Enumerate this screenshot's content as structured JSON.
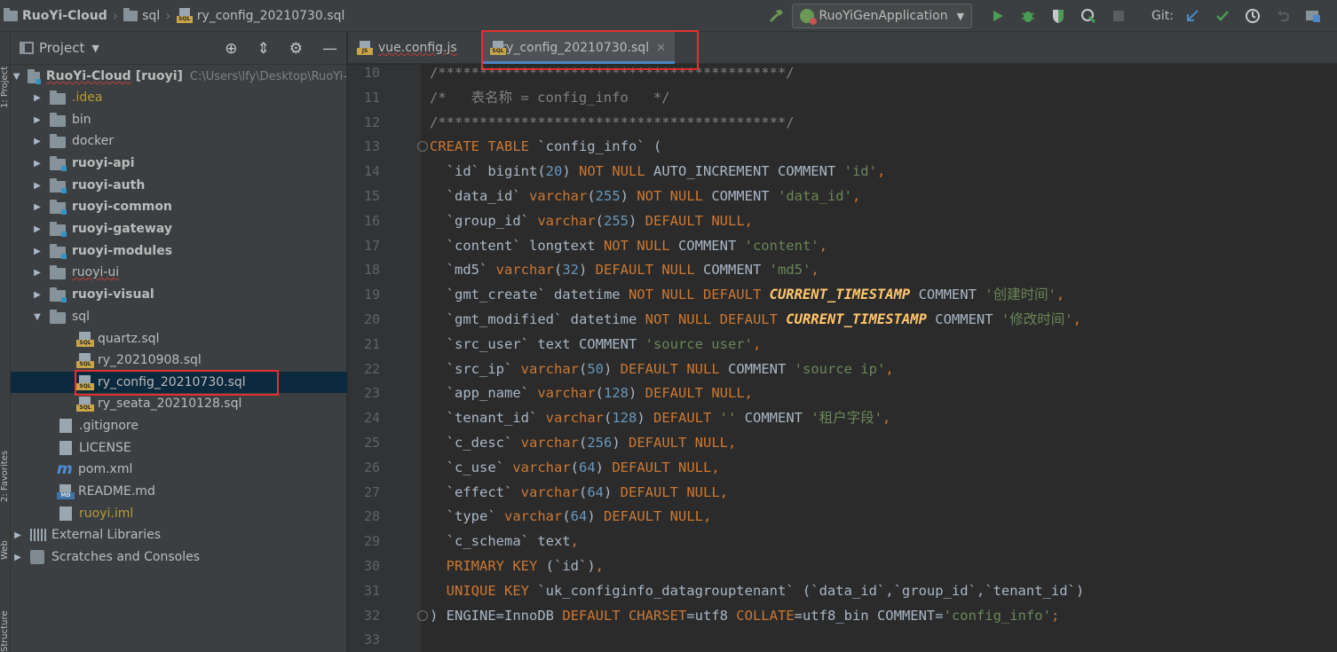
{
  "breadcrumb": {
    "project": "RuoYi-Cloud",
    "folder": "sql",
    "file": "ry_config_20210730.sql"
  },
  "toolbar": {
    "run_config": "RuoYiGenApplication",
    "git_label": "Git:",
    "icons": [
      "hammer-icon",
      "run-icon",
      "debug-icon",
      "coverage-icon",
      "profile-icon",
      "stop-icon",
      "git-update-icon",
      "git-commit-icon",
      "history-icon",
      "rollback-icon",
      "project-structure-icon"
    ],
    "colors": {
      "run": "#499c54",
      "accent": "#4a88c7",
      "selection": "#0d293e"
    }
  },
  "left_strip": {
    "project_label": "1: Project",
    "favorites_label": "2: Favorites",
    "web_label": "Web",
    "structure_label": "Structure"
  },
  "project_panel": {
    "title": "Project",
    "root_name": "RuoYi-Cloud",
    "root_module": "[ruoyi]",
    "root_path": "C:\\Users\\lfy\\Desktop\\RuoYi-",
    "items": [
      {
        "label": ".idea"
      },
      {
        "label": "bin"
      },
      {
        "label": "docker"
      },
      {
        "label": "ruoyi-api"
      },
      {
        "label": "ruoyi-auth"
      },
      {
        "label": "ruoyi-common"
      },
      {
        "label": "ruoyi-gateway"
      },
      {
        "label": "ruoyi-modules"
      },
      {
        "label": "ruoyi-ui"
      },
      {
        "label": "ruoyi-visual"
      },
      {
        "label": "sql"
      },
      {
        "label": "quartz.sql"
      },
      {
        "label": "ry_20210908.sql"
      },
      {
        "label": "ry_config_20210730.sql"
      },
      {
        "label": "ry_seata_20210128.sql"
      },
      {
        "label": ".gitignore"
      },
      {
        "label": "LICENSE"
      },
      {
        "label": "pom.xml"
      },
      {
        "label": "README.md"
      },
      {
        "label": "ruoyi.iml"
      },
      {
        "label": "External Libraries"
      },
      {
        "label": "Scratches and Consoles"
      }
    ]
  },
  "editor": {
    "tabs": [
      {
        "label": "vue.config.js",
        "icon_badge": "JS"
      },
      {
        "label": "ry_config_20210730.sql",
        "icon_badge": "SQL"
      }
    ],
    "line_numbers": [
      "10",
      "11",
      "12",
      "13",
      "14",
      "15",
      "16",
      "17",
      "18",
      "19",
      "20",
      "21",
      "22",
      "23",
      "24",
      "25",
      "26",
      "27",
      "28",
      "29",
      "30",
      "31",
      "32",
      "33"
    ],
    "code": [
      [
        {
          "t": "/******************************************/",
          "c": "comment"
        }
      ],
      [
        {
          "t": "/*   表名称 = config_info   */",
          "c": "comment"
        }
      ],
      [
        {
          "t": "/******************************************/",
          "c": "comment"
        }
      ],
      [
        {
          "t": "CREATE TABLE",
          "c": "kw"
        },
        {
          "t": " `config_info` (",
          "c": "id"
        }
      ],
      [
        {
          "t": "  `id` bigint(",
          "c": "id"
        },
        {
          "t": "20",
          "c": "num"
        },
        {
          "t": ") ",
          "c": "id"
        },
        {
          "t": "NOT NULL",
          "c": "kw"
        },
        {
          "t": " AUTO_INCREMENT COMMENT ",
          "c": "id"
        },
        {
          "t": "'id'",
          "c": "str"
        },
        {
          "t": ",",
          "c": "kw"
        }
      ],
      [
        {
          "t": "  `data_id` ",
          "c": "id"
        },
        {
          "t": "varchar",
          "c": "kw"
        },
        {
          "t": "(",
          "c": "id"
        },
        {
          "t": "255",
          "c": "num"
        },
        {
          "t": ") ",
          "c": "id"
        },
        {
          "t": "NOT NULL",
          "c": "kw"
        },
        {
          "t": " COMMENT ",
          "c": "id"
        },
        {
          "t": "'data_id'",
          "c": "str"
        },
        {
          "t": ",",
          "c": "kw"
        }
      ],
      [
        {
          "t": "  `group_id` ",
          "c": "id"
        },
        {
          "t": "varchar",
          "c": "kw"
        },
        {
          "t": "(",
          "c": "id"
        },
        {
          "t": "255",
          "c": "num"
        },
        {
          "t": ") ",
          "c": "id"
        },
        {
          "t": "DEFAULT NULL",
          "c": "kw"
        },
        {
          "t": ",",
          "c": "kw"
        }
      ],
      [
        {
          "t": "  `content` longtext ",
          "c": "id"
        },
        {
          "t": "NOT NULL",
          "c": "kw"
        },
        {
          "t": " COMMENT ",
          "c": "id"
        },
        {
          "t": "'content'",
          "c": "str"
        },
        {
          "t": ",",
          "c": "kw"
        }
      ],
      [
        {
          "t": "  `md5` ",
          "c": "id"
        },
        {
          "t": "varchar",
          "c": "kw"
        },
        {
          "t": "(",
          "c": "id"
        },
        {
          "t": "32",
          "c": "num"
        },
        {
          "t": ") ",
          "c": "id"
        },
        {
          "t": "DEFAULT NULL",
          "c": "kw"
        },
        {
          "t": " COMMENT ",
          "c": "id"
        },
        {
          "t": "'md5'",
          "c": "str"
        },
        {
          "t": ",",
          "c": "kw"
        }
      ],
      [
        {
          "t": "  `gmt_create` datetime ",
          "c": "id"
        },
        {
          "t": "NOT NULL DEFAULT ",
          "c": "kw"
        },
        {
          "t": "CURRENT_TIMESTAMP",
          "c": "fn"
        },
        {
          "t": " COMMENT ",
          "c": "id"
        },
        {
          "t": "'创建时间'",
          "c": "str"
        },
        {
          "t": ",",
          "c": "kw"
        }
      ],
      [
        {
          "t": "  `gmt_modified` datetime ",
          "c": "id"
        },
        {
          "t": "NOT NULL DEFAULT ",
          "c": "kw"
        },
        {
          "t": "CURRENT_TIMESTAMP",
          "c": "fn"
        },
        {
          "t": " COMMENT ",
          "c": "id"
        },
        {
          "t": "'修改时间'",
          "c": "str"
        },
        {
          "t": ",",
          "c": "kw"
        }
      ],
      [
        {
          "t": "  `src_user` text COMMENT ",
          "c": "id"
        },
        {
          "t": "'source user'",
          "c": "str"
        },
        {
          "t": ",",
          "c": "kw"
        }
      ],
      [
        {
          "t": "  `src_ip` ",
          "c": "id"
        },
        {
          "t": "varchar",
          "c": "kw"
        },
        {
          "t": "(",
          "c": "id"
        },
        {
          "t": "50",
          "c": "num"
        },
        {
          "t": ") ",
          "c": "id"
        },
        {
          "t": "DEFAULT NULL",
          "c": "kw"
        },
        {
          "t": " COMMENT ",
          "c": "id"
        },
        {
          "t": "'source ip'",
          "c": "str"
        },
        {
          "t": ",",
          "c": "kw"
        }
      ],
      [
        {
          "t": "  `app_name` ",
          "c": "id"
        },
        {
          "t": "varchar",
          "c": "kw"
        },
        {
          "t": "(",
          "c": "id"
        },
        {
          "t": "128",
          "c": "num"
        },
        {
          "t": ") ",
          "c": "id"
        },
        {
          "t": "DEFAULT NULL",
          "c": "kw"
        },
        {
          "t": ",",
          "c": "kw"
        }
      ],
      [
        {
          "t": "  `tenant_id` ",
          "c": "id"
        },
        {
          "t": "varchar",
          "c": "kw"
        },
        {
          "t": "(",
          "c": "id"
        },
        {
          "t": "128",
          "c": "num"
        },
        {
          "t": ") ",
          "c": "id"
        },
        {
          "t": "DEFAULT",
          "c": "kw"
        },
        {
          "t": " ",
          "c": "id"
        },
        {
          "t": "''",
          "c": "str"
        },
        {
          "t": " COMMENT ",
          "c": "id"
        },
        {
          "t": "'租户字段'",
          "c": "str"
        },
        {
          "t": ",",
          "c": "kw"
        }
      ],
      [
        {
          "t": "  `c_desc` ",
          "c": "id"
        },
        {
          "t": "varchar",
          "c": "kw"
        },
        {
          "t": "(",
          "c": "id"
        },
        {
          "t": "256",
          "c": "num"
        },
        {
          "t": ") ",
          "c": "id"
        },
        {
          "t": "DEFAULT NULL",
          "c": "kw"
        },
        {
          "t": ",",
          "c": "kw"
        }
      ],
      [
        {
          "t": "  `c_use` ",
          "c": "id"
        },
        {
          "t": "varchar",
          "c": "kw"
        },
        {
          "t": "(",
          "c": "id"
        },
        {
          "t": "64",
          "c": "num"
        },
        {
          "t": ") ",
          "c": "id"
        },
        {
          "t": "DEFAULT NULL",
          "c": "kw"
        },
        {
          "t": ",",
          "c": "kw"
        }
      ],
      [
        {
          "t": "  `effect` ",
          "c": "id"
        },
        {
          "t": "varchar",
          "c": "kw"
        },
        {
          "t": "(",
          "c": "id"
        },
        {
          "t": "64",
          "c": "num"
        },
        {
          "t": ") ",
          "c": "id"
        },
        {
          "t": "DEFAULT NULL",
          "c": "kw"
        },
        {
          "t": ",",
          "c": "kw"
        }
      ],
      [
        {
          "t": "  `type` ",
          "c": "id"
        },
        {
          "t": "varchar",
          "c": "kw"
        },
        {
          "t": "(",
          "c": "id"
        },
        {
          "t": "64",
          "c": "num"
        },
        {
          "t": ") ",
          "c": "id"
        },
        {
          "t": "DEFAULT NULL",
          "c": "kw"
        },
        {
          "t": ",",
          "c": "kw"
        }
      ],
      [
        {
          "t": "  `c_schema` text",
          "c": "id"
        },
        {
          "t": ",",
          "c": "kw"
        }
      ],
      [
        {
          "t": "  PRIMARY KEY",
          "c": "kw"
        },
        {
          "t": " (`id`)",
          "c": "id"
        },
        {
          "t": ",",
          "c": "kw"
        }
      ],
      [
        {
          "t": "  UNIQUE KEY",
          "c": "kw"
        },
        {
          "t": " `uk_configinfo_datagrouptenant` (`data_id`,`group_id`,`tenant_id`)",
          "c": "id"
        }
      ],
      [
        {
          "t": ") ENGINE=InnoDB ",
          "c": "id"
        },
        {
          "t": "DEFAULT CHARSET",
          "c": "kw"
        },
        {
          "t": "=utf8 ",
          "c": "id"
        },
        {
          "t": "COLLATE",
          "c": "kw"
        },
        {
          "t": "=utf8_bin COMMENT=",
          "c": "id"
        },
        {
          "t": "'config_info'",
          "c": "str"
        },
        {
          "t": ";",
          "c": "kw"
        }
      ],
      [
        {
          "t": "",
          "c": "id"
        }
      ]
    ]
  }
}
